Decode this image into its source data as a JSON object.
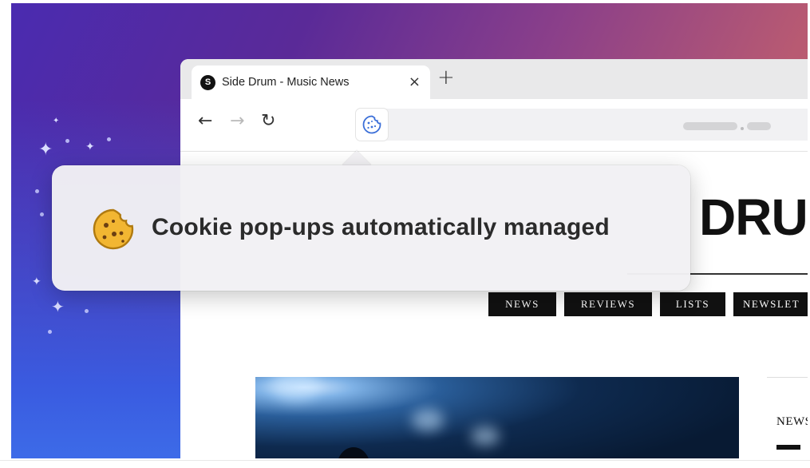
{
  "browser": {
    "tab": {
      "title": "Side Drum - Music News",
      "close_glyph": "×"
    },
    "new_tab_glyph": "+",
    "nav": {
      "back_glyph": "←",
      "forward_glyph": "→",
      "reload_glyph": "↻"
    },
    "address_bar": {
      "icon": "cookie-icon"
    }
  },
  "website": {
    "logo_text": "DRU",
    "nav_items": [
      "NEWS",
      "REVIEWS",
      "LISTS",
      "NEWSLET"
    ],
    "side_label": "NEWS"
  },
  "popup": {
    "icon": "cookie-icon",
    "message": "Cookie pop-ups automatically managed"
  },
  "colors": {
    "background_gradient_start": "#4a2bb0",
    "background_gradient_end": "#c9685c",
    "cookie_fill": "#f2b632",
    "cookie_outline": "#b07a10",
    "address_cookie_outline": "#3b6fd8"
  }
}
